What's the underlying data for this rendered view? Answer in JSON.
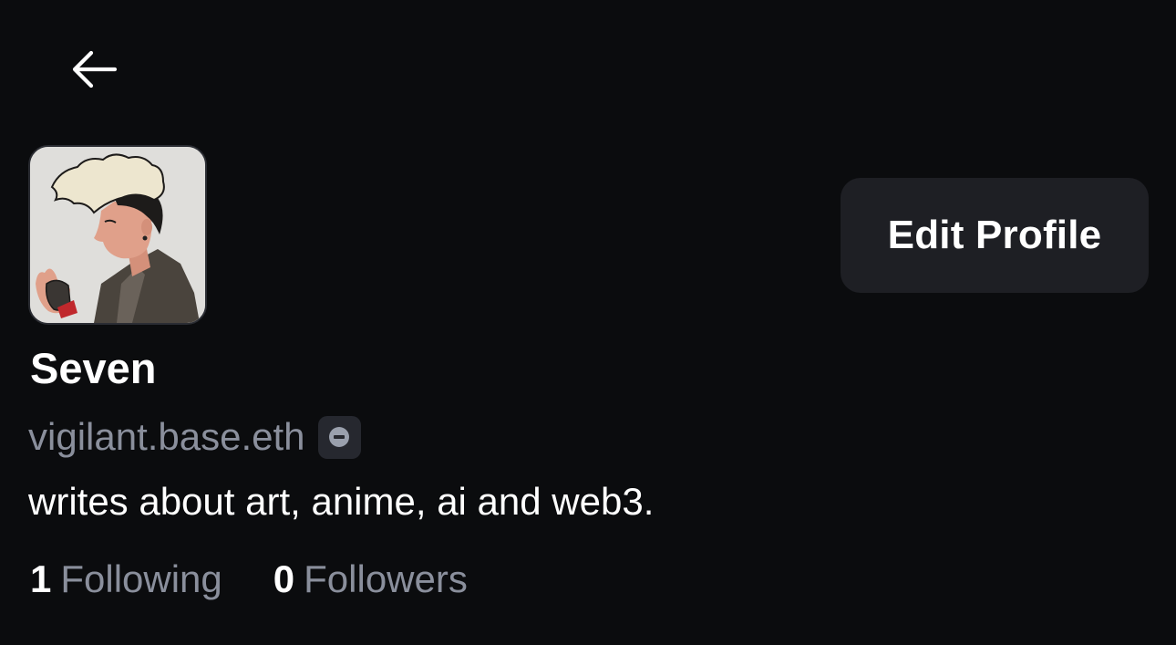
{
  "profile": {
    "display_name": "Seven",
    "handle": "vigilant.base.eth",
    "handle_badge_icon": "base-chain-icon",
    "bio": "writes about art, anime, ai and web3.",
    "avatar_icon": "anime-portrait-avatar"
  },
  "header": {
    "back_icon": "arrow-left-icon"
  },
  "actions": {
    "edit_profile_label": "Edit Profile"
  },
  "stats": {
    "following_count": "1",
    "following_label": "Following",
    "followers_count": "0",
    "followers_label": "Followers"
  },
  "colors": {
    "background": "#0b0c0e",
    "button_bg": "#1e1f24",
    "muted_text": "#8a8f9c",
    "primary_text": "#ffffff"
  }
}
